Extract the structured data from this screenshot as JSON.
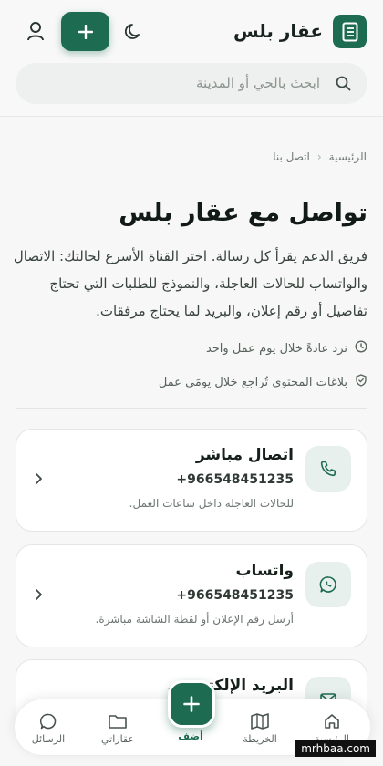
{
  "header": {
    "brand": "عقار بلس",
    "search_placeholder": "ابحث بالحي أو المدينة"
  },
  "breadcrumb": {
    "home": "الرئيسية",
    "current": "اتصل بنا"
  },
  "page": {
    "title": "تواصل مع عقار بلس",
    "intro": "فريق الدعم يقرأ كل رسالة. اختر القناة الأسرع لحالتك: الاتصال والواتساب للحالات العاجلة، والنموذج للطلبات التي تحتاج تفاصيل أو رقم إعلان، والبريد لما يحتاج مرفقات.",
    "meta_response": "نرد عادةً خلال يوم عمل واحد",
    "meta_reports": "بلاغات المحتوى تُراجع خلال يومَي عمل"
  },
  "cards": [
    {
      "title": "اتصال مباشر",
      "value": "+966548451235",
      "desc": "للحالات العاجلة داخل ساعات العمل.",
      "icon": "phone-icon"
    },
    {
      "title": "واتساب",
      "value": "+966548451235",
      "desc": "أرسل رقم الإعلان أو لقطة الشاشة مباشرة.",
      "icon": "whatsapp-icon"
    },
    {
      "title": "البريد الإلكتروني",
      "icon": "mail-icon"
    }
  ],
  "nav": {
    "home": "الرئيسية",
    "map": "الخريطة",
    "add": "أضف",
    "mine": "عقاراتي",
    "messages": "الرسائل"
  },
  "watermark": "mrhbaa.com",
  "colors": {
    "accent": "#1d6b50",
    "background": "#f6f7f6"
  }
}
